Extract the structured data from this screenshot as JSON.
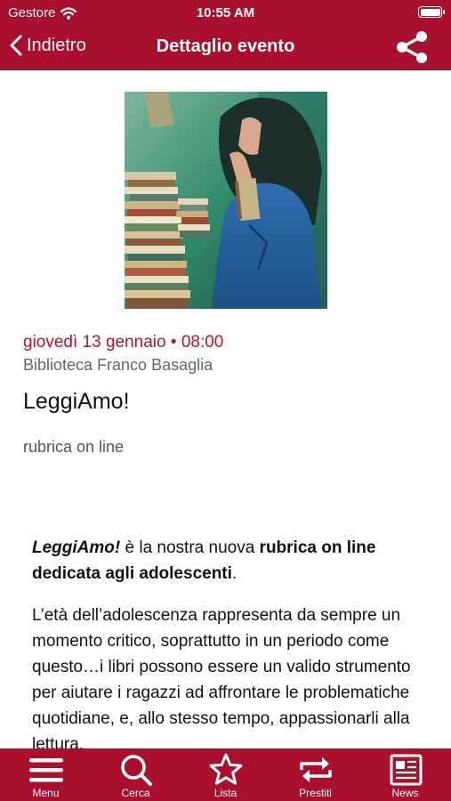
{
  "status_bar": {
    "carrier": "Gestore",
    "time": "10:55 AM"
  },
  "nav": {
    "back_label": "Indietro",
    "title": "Dettaglio evento"
  },
  "event": {
    "date": "giovedì 13 gennaio",
    "separator": "•",
    "time": "08:00",
    "venue": "Biblioteca Franco Basaglia",
    "title": "LeggiAmo!",
    "subtitle": "rubrica on line"
  },
  "description": {
    "p1_em": "LeggiAmo!",
    "p1_text1": " è la nostra nuova ",
    "p1_strong": "rubrica on line dedicata agli adolescenti",
    "p1_text2": ".",
    "p2": "L’età dell’adolescenza rappresenta da sempre un momento critico, soprattutto in un periodo come questo…i libri possono essere un valido strumento per aiutare i ragazzi ad affrontare le problematiche quotidiane, e, allo stesso tempo, appassionarli alla lettura."
  },
  "tabs": [
    {
      "label": "Menu",
      "icon": "menu-icon"
    },
    {
      "label": "Cerca",
      "icon": "search-icon"
    },
    {
      "label": "Lista",
      "icon": "star-icon"
    },
    {
      "label": "Prestiti",
      "icon": "repeat-icon"
    },
    {
      "label": "News",
      "icon": "newspaper-icon"
    }
  ],
  "colors": {
    "brand": "#a8102e",
    "accent_text": "#b5122c"
  }
}
